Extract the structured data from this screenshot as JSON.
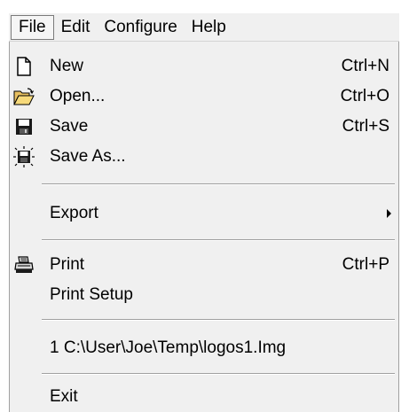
{
  "menubar": {
    "items": [
      {
        "label": "File"
      },
      {
        "label": "Edit"
      },
      {
        "label": "Configure"
      },
      {
        "label": "Help"
      }
    ]
  },
  "file_menu": {
    "items": [
      {
        "label": "New",
        "shortcut": "Ctrl+N",
        "icon": "new-document-icon"
      },
      {
        "label": "Open...",
        "shortcut": "Ctrl+O",
        "icon": "open-folder-icon"
      },
      {
        "label": "Save",
        "shortcut": "Ctrl+S",
        "icon": "floppy-disk-icon"
      },
      {
        "label": "Save As...",
        "shortcut": "",
        "icon": "save-as-icon"
      },
      {
        "label": "Export",
        "shortcut": "",
        "submenu": true
      },
      {
        "label": "Print",
        "shortcut": "Ctrl+P",
        "icon": "printer-icon"
      },
      {
        "label": "Print Setup",
        "shortcut": ""
      },
      {
        "label": "1 C:\\User\\Joe\\Temp\\logos1.Img",
        "shortcut": ""
      },
      {
        "label": "Exit",
        "shortcut": ""
      }
    ]
  }
}
